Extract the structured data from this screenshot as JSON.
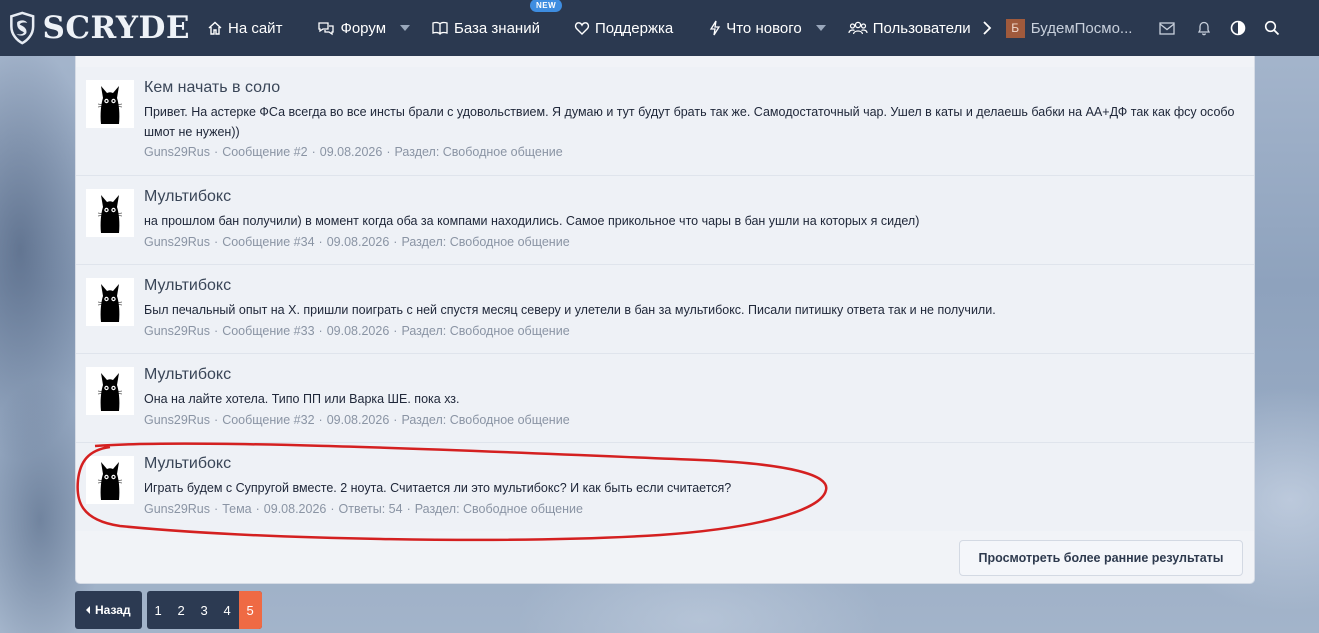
{
  "nav": {
    "logo": "SCRYDE",
    "items": [
      {
        "label": "На сайт",
        "icon": "home-icon"
      },
      {
        "label": "Форум",
        "icon": "chat-icon"
      },
      {
        "label": "База знаний",
        "icon": "book-icon",
        "badge": "NEW"
      },
      {
        "label": "Поддержка",
        "icon": "heart-icon"
      },
      {
        "label": "Что нового",
        "icon": "bolt-icon"
      },
      {
        "label": "Пользователи",
        "icon": "users-icon"
      }
    ],
    "user_initial": "Б",
    "user_name": "БудемПосмо..."
  },
  "results": [
    {
      "title": "Кем начать в соло",
      "snippet": "Привет. На астерке ФСа всегда во все инсты брали с удовольствием. Я думаю и тут будут брать так же. Самодостаточный чар. Ушел в каты и делаешь бабки на АА+ДФ так как фсу особо шмот не нужен))",
      "author": "Guns29Rus",
      "kind": "Сообщение #2",
      "date": "09.08.2026",
      "extra": "",
      "section": "Раздел: Свободное общение"
    },
    {
      "title": "Мультибокс",
      "snippet": "на прошлом бан получили) в момент когда оба за компами находились. Самое прикольное что чары в бан ушли на которых я сидел)",
      "author": "Guns29Rus",
      "kind": "Сообщение #34",
      "date": "09.08.2026",
      "extra": "",
      "section": "Раздел: Свободное общение"
    },
    {
      "title": "Мультибокс",
      "snippet": "Был печальный опыт на Х. пришли поиграть с ней спустя месяц северу и улетели в бан за мультибокс. Писали питишку ответа так и не получили.",
      "author": "Guns29Rus",
      "kind": "Сообщение #33",
      "date": "09.08.2026",
      "extra": "",
      "section": "Раздел: Свободное общение"
    },
    {
      "title": "Мультибокс",
      "snippet": "Она на лайте хотела. Типо ПП или Варка ШЕ. пока хз.",
      "author": "Guns29Rus",
      "kind": "Сообщение #32",
      "date": "09.08.2026",
      "extra": "",
      "section": "Раздел: Свободное общение"
    },
    {
      "title": "Мультибокс",
      "snippet": "Играть будем с Супругой вместе. 2 ноута. Считается ли это мультибокс? И как быть если считается?",
      "author": "Guns29Rus",
      "kind": "Тема",
      "date": "09.08.2026",
      "extra": "Ответы: 54",
      "section": "Раздел: Свободное общение"
    }
  ],
  "older_button": "Просмотреть более ранние результаты",
  "pagination": {
    "prev": "Назад",
    "pages": [
      "1",
      "2",
      "3",
      "4",
      "5"
    ],
    "current": "5"
  },
  "colors": {
    "nav_bg": "#2b3950",
    "accent_page": "#ef6a44",
    "annotation": "#d42020"
  }
}
